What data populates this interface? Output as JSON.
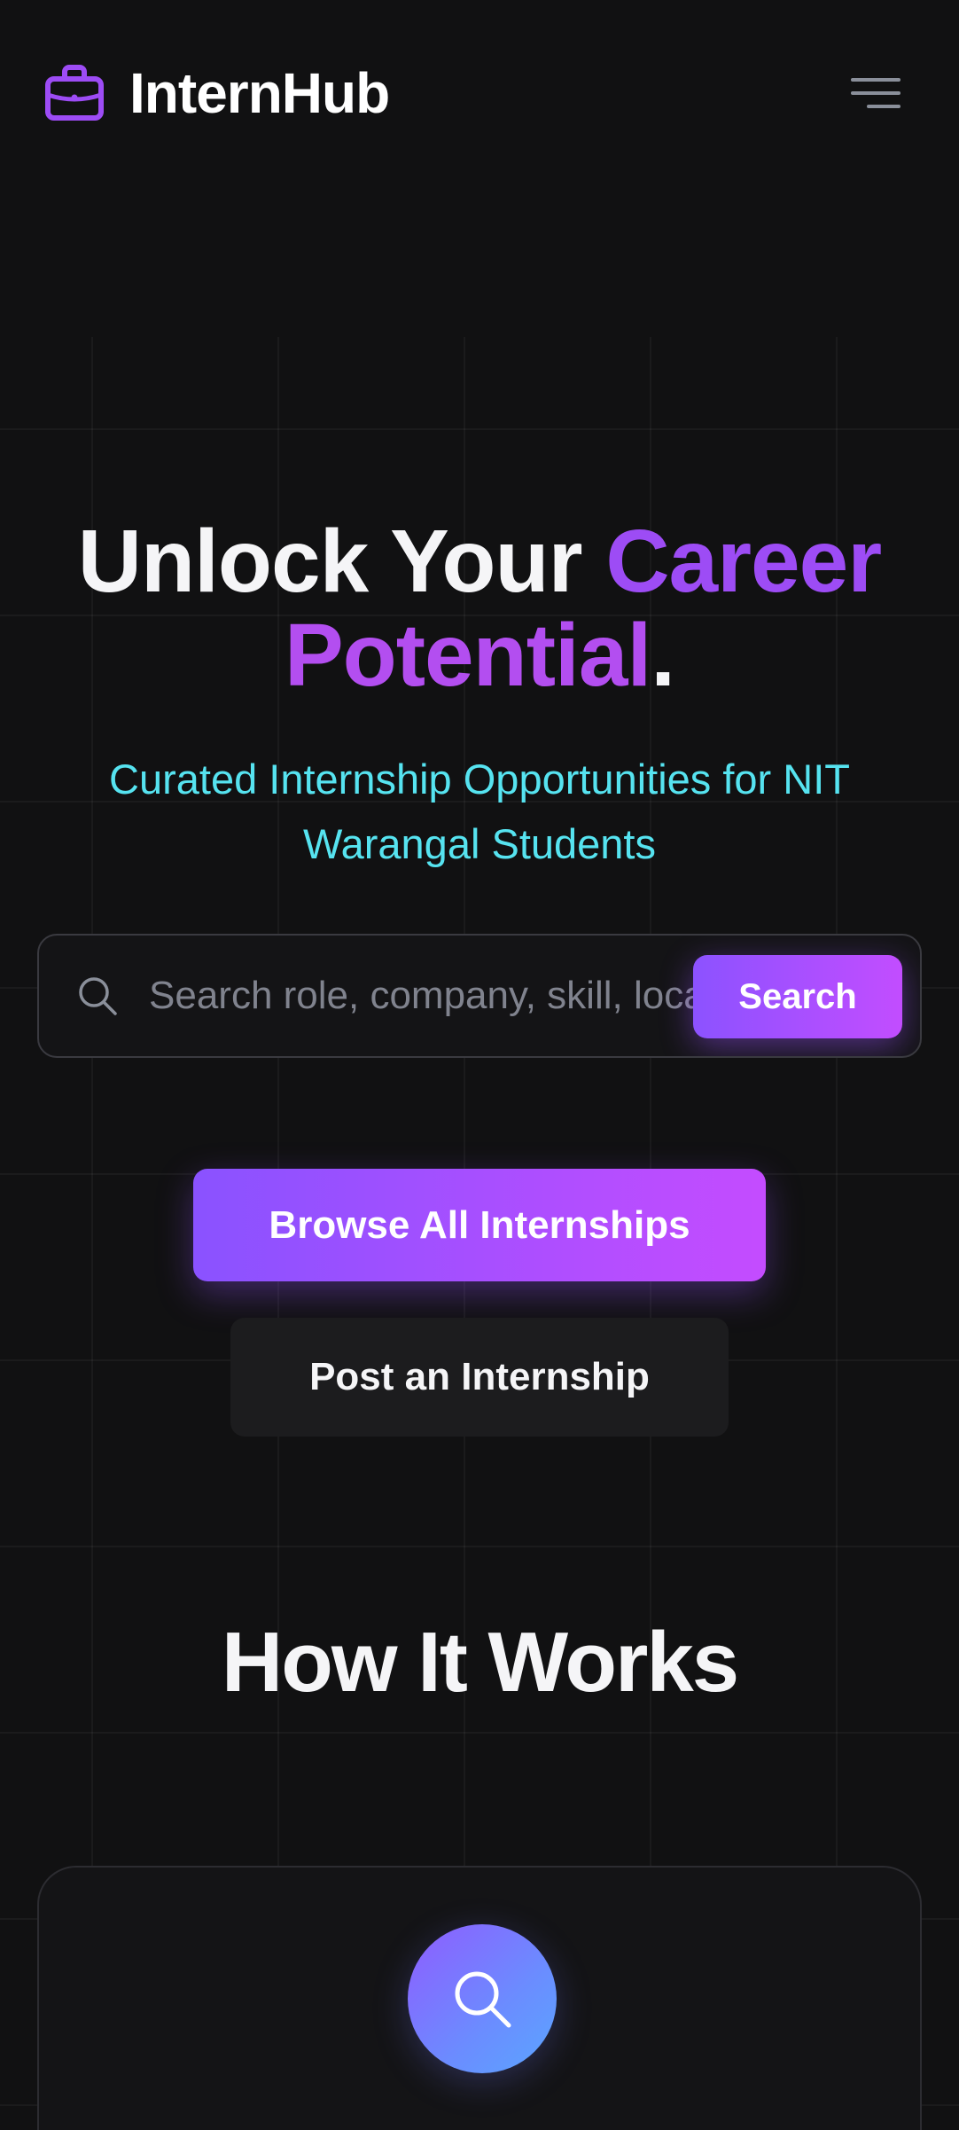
{
  "header": {
    "brand_name": "InternHub",
    "brand_icon": "briefcase-icon",
    "menu_icon": "hamburger-menu-icon"
  },
  "hero": {
    "title_part1": "Unlock Your ",
    "title_accent1": "Career",
    "title_accent2": "Potential",
    "title_end": ".",
    "subtitle": "Curated Internship Opportunities for NIT Warangal Students"
  },
  "search": {
    "icon": "search-icon",
    "placeholder": "Search role, company, skill, location...",
    "button_label": "Search"
  },
  "cta": {
    "primary_label": "Browse All Internships",
    "secondary_label": "Post an Internship"
  },
  "how_it_works": {
    "title": "How It Works",
    "step_icon": "search-icon"
  },
  "colors": {
    "background": "#111112",
    "accent_purple": "#9d4cf5",
    "accent_magenta": "#c24dff",
    "accent_cyan": "#56e3f0"
  }
}
